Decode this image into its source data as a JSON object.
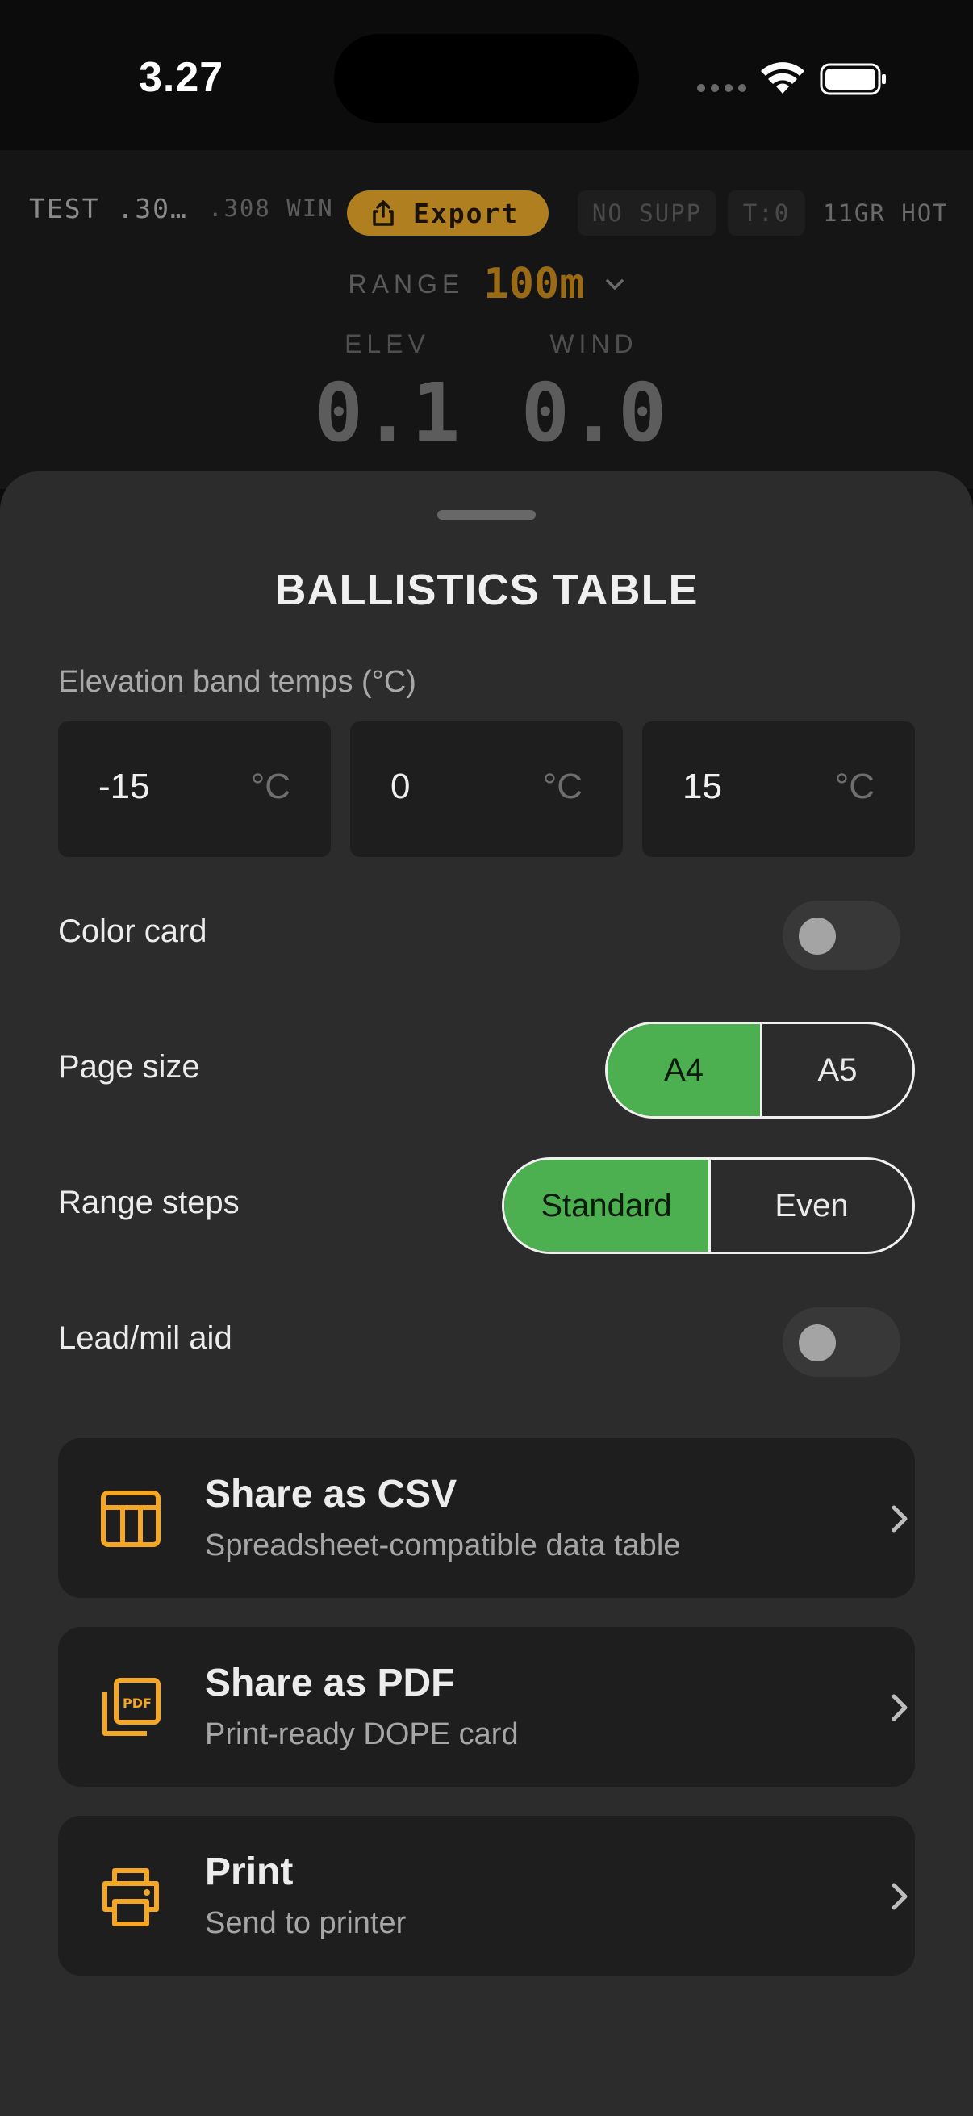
{
  "status_bar": {
    "time": "3.27"
  },
  "toolbar": {
    "profile": "TEST .30…",
    "ammo": ".308 WIN",
    "export_label": "Export",
    "chip_supp": "NO SUPP",
    "chip_t": "T:0",
    "hot": "11GR HOT"
  },
  "range": {
    "label": "RANGE",
    "value": "100m"
  },
  "readouts": {
    "elev_label": "ELEV",
    "elev_value": "0.1",
    "wind_label": "WIND",
    "wind_value": "0.0"
  },
  "sheet": {
    "title": "BALLISTICS TABLE",
    "elevation_band": {
      "label": "Elevation band temps (°C)",
      "temps": [
        {
          "value": "-15",
          "unit": "°C"
        },
        {
          "value": "0",
          "unit": "°C"
        },
        {
          "value": "15",
          "unit": "°C"
        }
      ]
    },
    "color_card": {
      "label": "Color card",
      "on": false
    },
    "page_size": {
      "label": "Page size",
      "options": [
        "A4",
        "A5"
      ],
      "selected": "A4"
    },
    "range_steps": {
      "label": "Range steps",
      "options": [
        "Standard",
        "Even"
      ],
      "selected": "Standard"
    },
    "lead_mil": {
      "label": "Lead/mil aid",
      "on": false
    },
    "actions": [
      {
        "title": "Share as CSV",
        "subtitle": "Spreadsheet-compatible data table",
        "icon": "table-icon"
      },
      {
        "title": "Share as PDF",
        "subtitle": "Print-ready DOPE card",
        "icon": "pdf-icon"
      },
      {
        "title": "Print",
        "subtitle": "Send to printer",
        "icon": "printer-icon"
      }
    ]
  },
  "colors": {
    "accent": "#f5a623",
    "active": "#4caf50",
    "sheet": "#2c2c2c",
    "card": "#1e1e1e"
  }
}
